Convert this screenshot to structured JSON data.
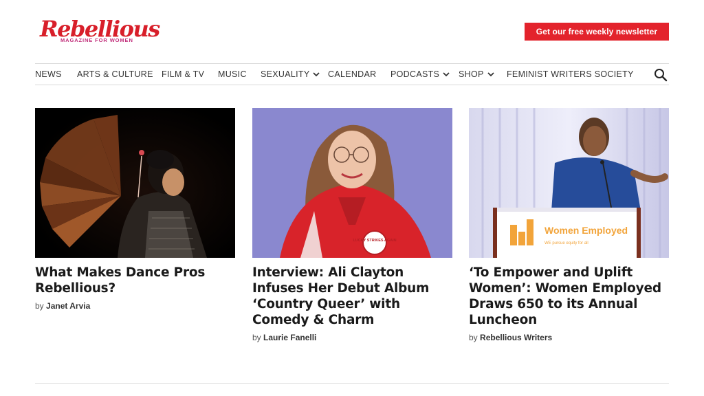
{
  "brand": {
    "name": "Rebellious",
    "tagline": "MAGAZINE FOR WOMEN",
    "colors": {
      "primary_red": "#e3232c",
      "tagline_pink": "#c12d7a"
    }
  },
  "header": {
    "newsletter_label": "Get our free weekly newsletter"
  },
  "nav": {
    "items": [
      {
        "label": "NEWS",
        "has_dropdown": false
      },
      {
        "label": "ARTS & CULTURE",
        "has_dropdown": false
      },
      {
        "label": "FILM & TV",
        "has_dropdown": false
      },
      {
        "label": "MUSIC",
        "has_dropdown": false
      },
      {
        "label": "SEXUALITY",
        "has_dropdown": true
      },
      {
        "label": "CALENDAR",
        "has_dropdown": false
      },
      {
        "label": "PODCASTS",
        "has_dropdown": true
      },
      {
        "label": "SHOP",
        "has_dropdown": true
      },
      {
        "label": "FEMINIST WRITERS SOCIETY",
        "has_dropdown": false
      }
    ],
    "search_icon": "search-icon"
  },
  "articles": [
    {
      "title": "What Makes Dance Pros Rebellious?",
      "by": "by",
      "author": "Janet Arvia"
    },
    {
      "title": "Interview: Ali Clayton Infuses Her Debut Album ‘Country Queer’ with Comedy & Charm",
      "by": "by",
      "author": "Laurie Fanelli",
      "badge_text": "LUCKY STRIKES AGAIN"
    },
    {
      "title": "‘To Empower and Uplift Women’: Women Employed Draws 650 to its Annual Luncheon",
      "by": "by",
      "author": "Rebellious Writers",
      "podium_text": "Women Employed",
      "podium_subtext": "WE pursue equity for all"
    }
  ]
}
